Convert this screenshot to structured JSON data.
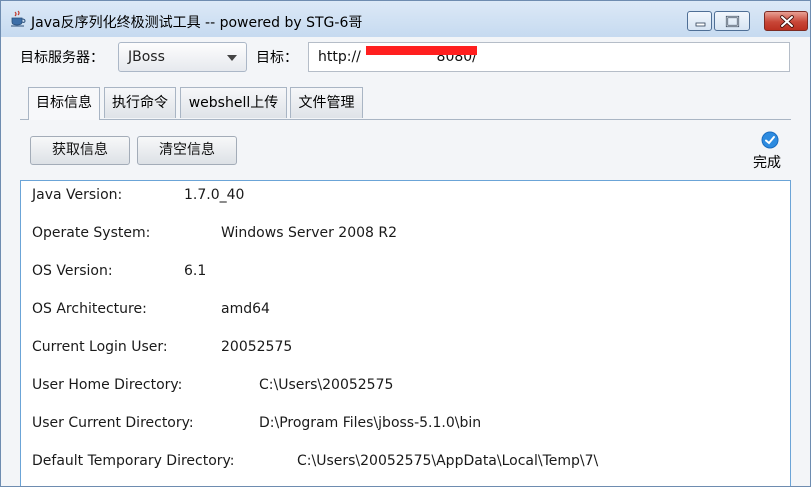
{
  "window": {
    "title": "Java反序列化终极测试工具  -- powered by STG-6哥",
    "app_icon": "java-cup-icon"
  },
  "toolbar": {
    "server_label": "目标服务器：",
    "server_selected": "JBoss",
    "target_label": "目标：",
    "target_url": "http://                 8080/"
  },
  "tabs": [
    {
      "label": "目标信息",
      "active": true
    },
    {
      "label": "执行命令",
      "active": false
    },
    {
      "label": "webshell上传",
      "active": false
    },
    {
      "label": "文件管理",
      "active": false
    }
  ],
  "actions": {
    "fetch_label": "获取信息",
    "clear_label": "清空信息"
  },
  "status": {
    "icon": "check-circle-icon",
    "text": "完成",
    "color": "#2d8be0"
  },
  "info": [
    {
      "key": "Java Version:",
      "value": "1.7.0_40"
    },
    {
      "key": "Operate System:",
      "value": "Windows Server 2008 R2"
    },
    {
      "key": "OS Version:",
      "value": "6.1"
    },
    {
      "key": "OS Architecture:",
      "value": "amd64"
    },
    {
      "key": "Current Login User:",
      "value": "20052575"
    },
    {
      "key": "User Home Directory:",
      "value": "C:\\Users\\20052575"
    },
    {
      "key": "User Current Directory:",
      "value": "D:\\Program Files\\jboss-5.1.0\\bin"
    },
    {
      "key": "Default Temporary Directory:",
      "value": "C:\\Users\\20052575\\AppData\\Local\\Temp\\7\\"
    }
  ],
  "colors": {
    "redaction": "#ff1f1f",
    "panel_border": "#6ba4d7"
  }
}
